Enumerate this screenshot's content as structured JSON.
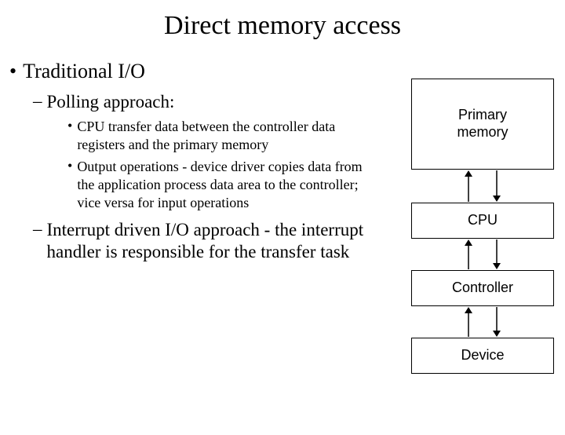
{
  "title": "Direct memory access",
  "bullet1": "Traditional I/O",
  "bullet2a": "Polling approach:",
  "bullet3a": "CPU transfer data between the controller data registers and the primary memory",
  "bullet3b": "Output operations - device driver copies data from the application process data area to the controller; vice versa for input operations",
  "bullet2b": "Interrupt driven I/O approach - the interrupt handler is responsible for the transfer task",
  "diagram": {
    "mem": "Primary\nmemory",
    "cpu": "CPU",
    "ctrl": "Controller",
    "dev": "Device"
  }
}
